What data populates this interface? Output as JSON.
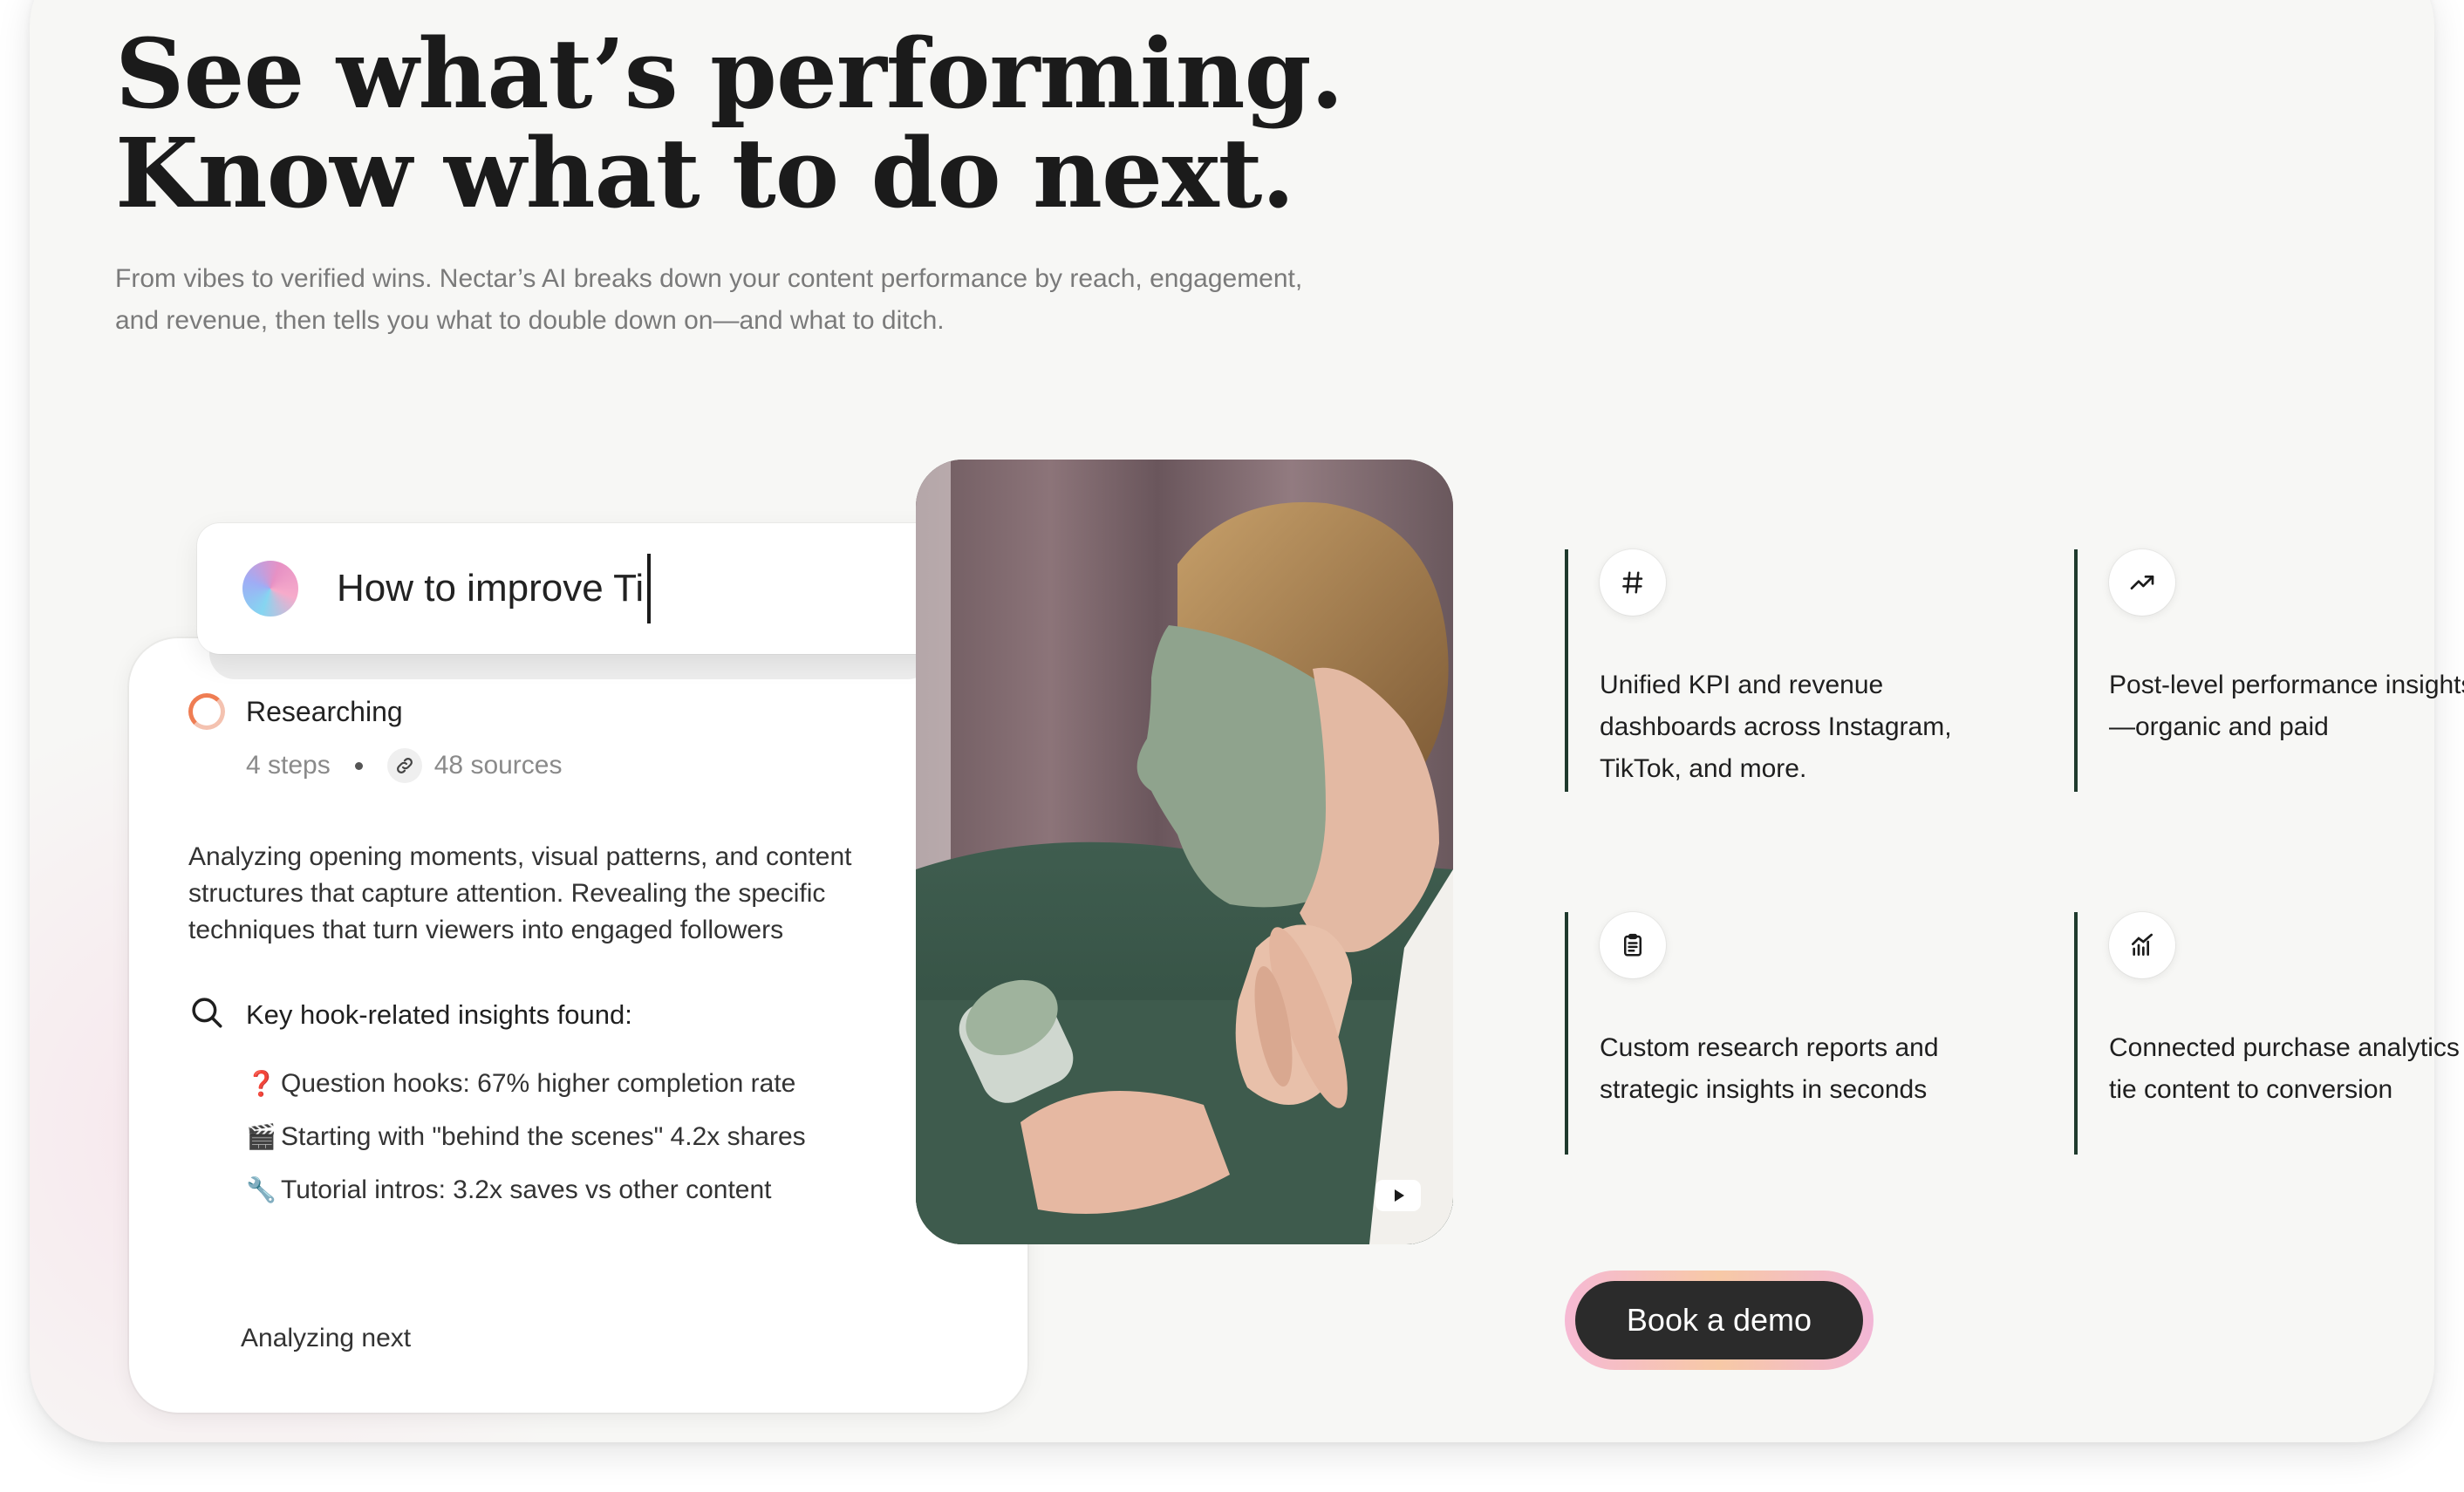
{
  "hero": {
    "headline_line1": "See what’s performing.",
    "headline_line2": "Know what to do next.",
    "subcopy": "From vibes to verified wins. Nectar’s AI breaks down your content performance by reach, engagement, and revenue, then tells you what to double down on—and what to ditch."
  },
  "prompt": {
    "text": "How to improve Ti",
    "icon": "gradient-orb-icon"
  },
  "research": {
    "status": "Researching",
    "steps": "4 steps",
    "sources": "48 sources",
    "analysis": "Analyzing opening moments, visual patterns, and content structures that capture attention. Revealing the specific techniques that turn viewers into engaged followers",
    "insights_heading": "Key hook-related insights found:",
    "insights": [
      {
        "emoji": "❓",
        "text": "Question hooks: 67% higher completion rate"
      },
      {
        "emoji": "🎬",
        "text": "Starting with \"behind the scenes\" 4.2x shares"
      },
      {
        "emoji": "🔧",
        "text": "Tutorial intros: 3.2x saves vs other content"
      }
    ],
    "footer": "Analyzing next"
  },
  "video": {
    "icon": "youtube-play-icon"
  },
  "features": [
    {
      "icon": "hashtag-icon",
      "text": "Unified KPI and revenue dashboards across Instagram, TikTok, and more."
    },
    {
      "icon": "trending-up-icon",
      "text": "Post-level performance insights—organic and paid"
    },
    {
      "icon": "clipboard-icon",
      "text": "Custom research reports and strategic insights in seconds"
    },
    {
      "icon": "analytics-chart-icon",
      "text": "Connected purchase analytics to tie content to conversion"
    }
  ],
  "cta": {
    "label": "Book a demo"
  },
  "colors": {
    "accent_line": "#1f3a2d",
    "cta_background": "#2b2b2b",
    "spinner": "#ef7d53",
    "page_background": "#f7f7f5"
  }
}
